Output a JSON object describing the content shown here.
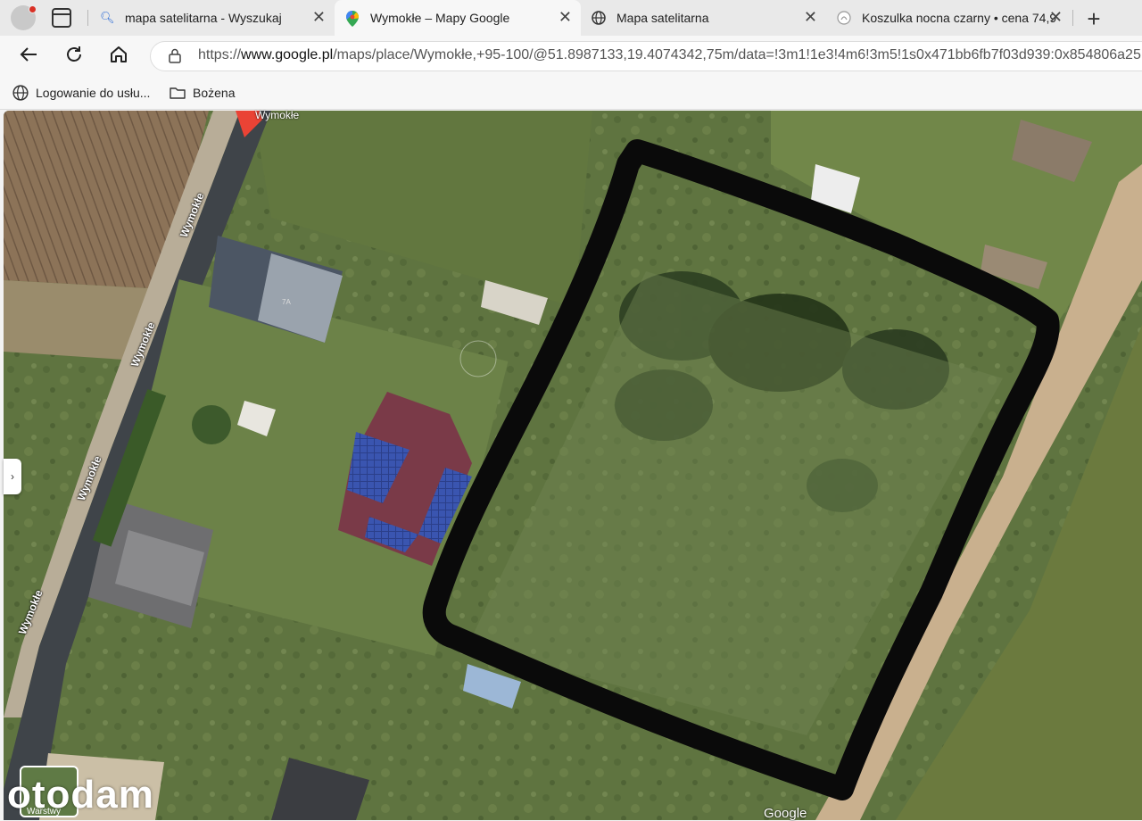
{
  "browser": {
    "tabs": [
      {
        "title": "mapa satelitarna - Wyszukaj",
        "icon": "search-icon"
      },
      {
        "title": "Wymokłe – Mapy Google",
        "icon": "google-maps-icon"
      },
      {
        "title": "Mapa satelitarna",
        "icon": "globe-icon"
      },
      {
        "title": "Koszulka nocna czarny • cena 74,9",
        "icon": "site-icon"
      }
    ],
    "close_glyph": "✕",
    "new_tab_glyph": "+",
    "url_prefix": "https://",
    "url_host": "www.google.pl",
    "url_path": "/maps/place/Wymokłe,+95-100/@51.8987133,19.4074342,75m/data=!3m1!1e3!4m6!3m5!1s0x471bb6fb7f03d939:0x854806a25",
    "bookmarks": [
      "Logowanie do usłu...",
      "Bożena"
    ]
  },
  "map": {
    "road_name": "Wymokłe",
    "house_number": "7A",
    "pin_label": "Wymokłe",
    "layers_label": "Warstwy",
    "watermark": "otodam",
    "provider": "Google",
    "side_glyph": "›"
  },
  "colors": {
    "boundary": "#0a0a0a",
    "grass": "#5f7440",
    "road": "#3f4449",
    "dirt_road": "#c9b08e"
  }
}
